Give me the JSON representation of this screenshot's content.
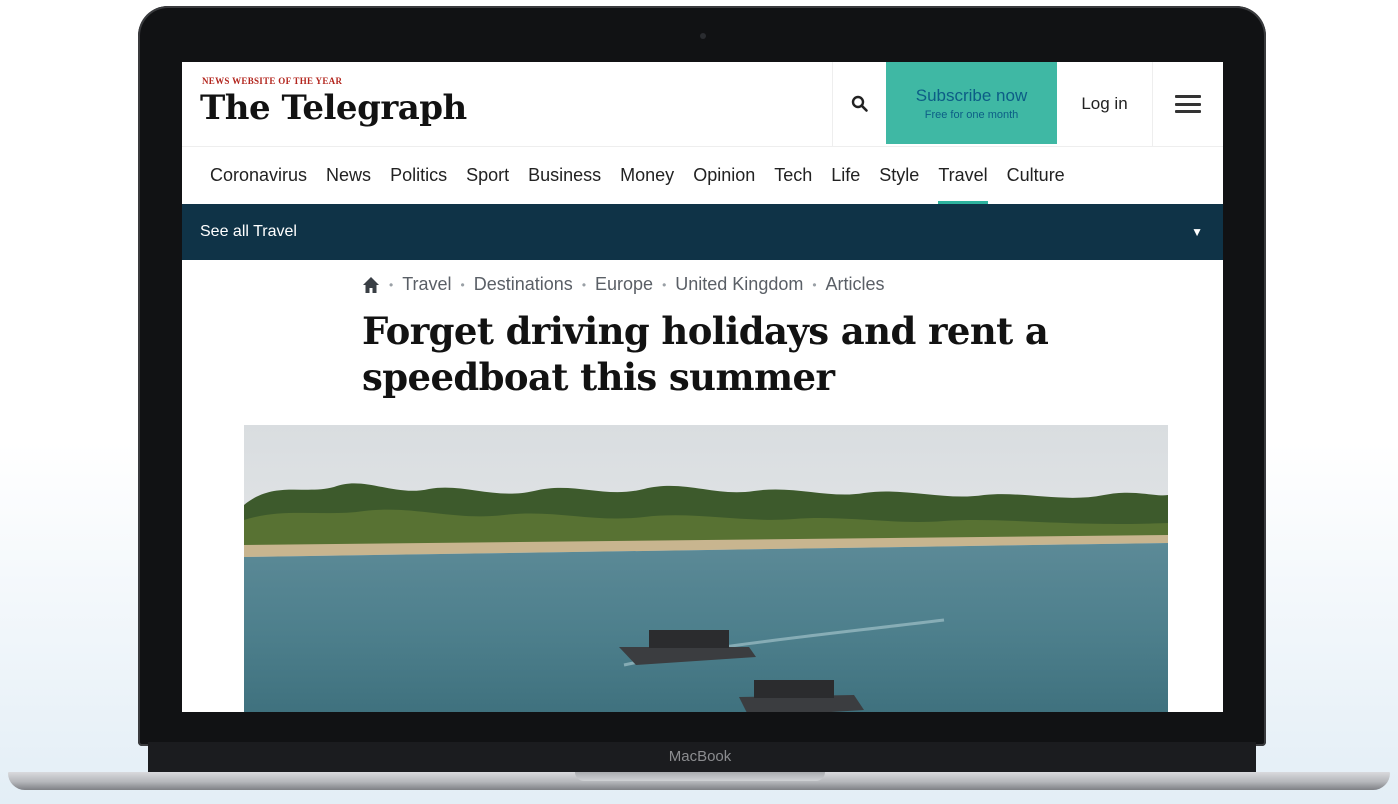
{
  "device": {
    "label": "MacBook"
  },
  "masthead": {
    "tagline": "NEWS WEBSITE OF THE YEAR",
    "logo": "The Telegraph"
  },
  "header": {
    "search_icon": "search-icon",
    "subscribe_label": "Subscribe now",
    "subscribe_sublabel": "Free for one month",
    "login_label": "Log in",
    "menu_icon": "hamburger-icon"
  },
  "nav": {
    "items": [
      {
        "label": "Coronavirus"
      },
      {
        "label": "News"
      },
      {
        "label": "Politics"
      },
      {
        "label": "Sport"
      },
      {
        "label": "Business"
      },
      {
        "label": "Money"
      },
      {
        "label": "Opinion"
      },
      {
        "label": "Tech"
      },
      {
        "label": "Life"
      },
      {
        "label": "Style"
      },
      {
        "label": "Travel"
      },
      {
        "label": "Culture"
      }
    ],
    "active": "Travel"
  },
  "subnav": {
    "label": "See all Travel"
  },
  "breadcrumb": {
    "items": [
      "Travel",
      "Destinations",
      "Europe",
      "United Kingdom",
      "Articles"
    ]
  },
  "article": {
    "headline": "Forget driving holidays and rent a speedboat this summer"
  },
  "colors": {
    "accent_teal": "#3fb8a4",
    "subnav_bg": "#0f3347",
    "tagline_red": "#b3261e",
    "subscribe_text": "#0c5d86"
  }
}
